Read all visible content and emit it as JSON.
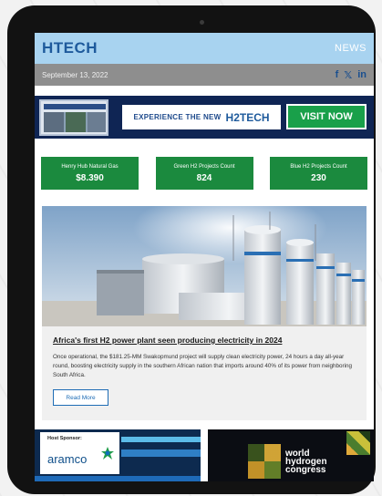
{
  "header": {
    "logo_h": "H",
    "logo_rest": "TECH",
    "news_label": "NEWS"
  },
  "datebar": {
    "date": "September 13, 2022",
    "social": {
      "facebook": "f",
      "twitter": "𝕏",
      "linkedin": "in"
    }
  },
  "banner": {
    "message": "EXPERIENCE THE NEW",
    "brand": "H2TECH",
    "cta": "VISIT NOW"
  },
  "stats": [
    {
      "label": "Henry Hub Natural Gas",
      "value": "$8.390"
    },
    {
      "label": "Green H2 Projects Count",
      "value": "824"
    },
    {
      "label": "Blue H2 Projects Count",
      "value": "230"
    }
  ],
  "article": {
    "title": "Africa's first H2 power plant seen producing electricity in 2024",
    "body": "Once operational, the $181.25-MM Swakopmund project will supply clean electricity power, 24 hours a day all-year round, boosting electricity supply in the southern African nation that imports around 40% of its power from neighboring South Africa.",
    "read_more": "Read More"
  },
  "sponsors": {
    "host_label": "Host Sponsor:",
    "host_name": "aramco",
    "event_line1": "world",
    "event_line2": "hydrogen",
    "event_line3": "congress"
  },
  "colors": {
    "header_bg": "#a8d3f0",
    "brand_blue": "#1e5a9c",
    "stat_green": "#1b8a3e",
    "cta_green": "#19a04a",
    "banner_navy": "#0f2554"
  }
}
